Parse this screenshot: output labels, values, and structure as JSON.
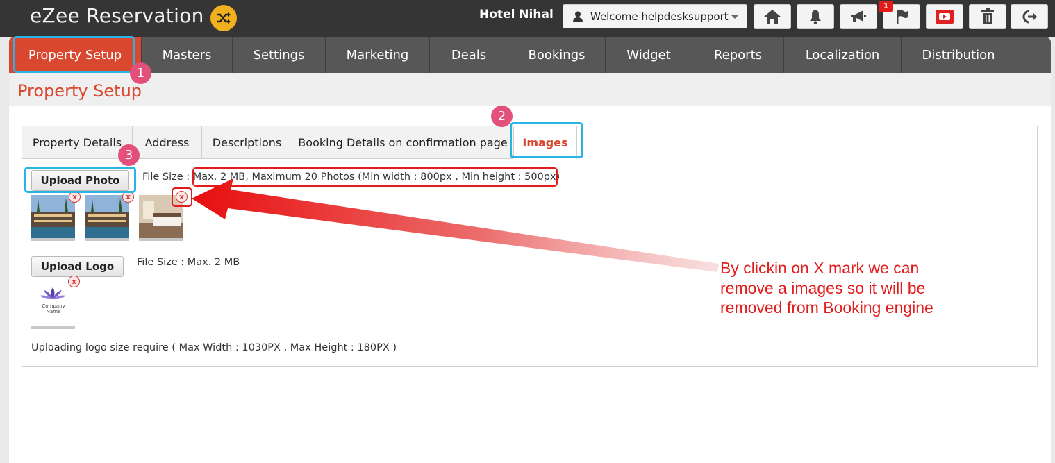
{
  "app": {
    "title": "eZee Reservation",
    "badge_icon": "shuffle-icon",
    "hotel_name": "Hotel Nihal",
    "welcome_text": "Welcome helpdesksupport",
    "notification_count": "1"
  },
  "toolbar_icons": [
    "home-icon",
    "bell-icon",
    "megaphone-icon",
    "flag-icon",
    "youtube-icon",
    "trash-icon",
    "logout-icon"
  ],
  "nav": {
    "items": [
      {
        "label": "Property Setup",
        "active": true
      },
      {
        "label": "Masters"
      },
      {
        "label": "Settings"
      },
      {
        "label": "Marketing"
      },
      {
        "label": "Deals"
      },
      {
        "label": "Bookings"
      },
      {
        "label": "Widget"
      },
      {
        "label": "Reports"
      },
      {
        "label": "Localization"
      },
      {
        "label": "Distribution"
      }
    ]
  },
  "page": {
    "title": "Property Setup"
  },
  "tabs": [
    {
      "label": "Property Details"
    },
    {
      "label": "Address"
    },
    {
      "label": "Descriptions"
    },
    {
      "label": "Booking Details on confirmation page"
    },
    {
      "label": "Images",
      "active": true
    }
  ],
  "images_tab": {
    "upload_photo_label": "Upload Photo",
    "photo_filesize_prefix": "File Size : ",
    "photo_filesize_main": "Max. 2 MB, Maximum 20 Photos (Min width : 800px , Min height : 500px",
    "photo_filesize_suffix": ")",
    "upload_logo_label": "Upload Logo",
    "logo_filesize": "File Size : Max. 2 MB",
    "logo_note": "Uploading logo size require ( Max Width : 1030PX , Max Height : 180PX )",
    "remove_mark": "x",
    "logo_company_text": "Company Name"
  },
  "annotation": {
    "steps": [
      "1",
      "2",
      "3"
    ],
    "note": "By clickin on X mark we can remove a images so it will be removed from Booking engine"
  },
  "colors": {
    "accent": "#d9472f",
    "highlight_blue": "#29b4e6",
    "annotation_red": "#e21c1c",
    "step_pink": "#e3507c"
  }
}
